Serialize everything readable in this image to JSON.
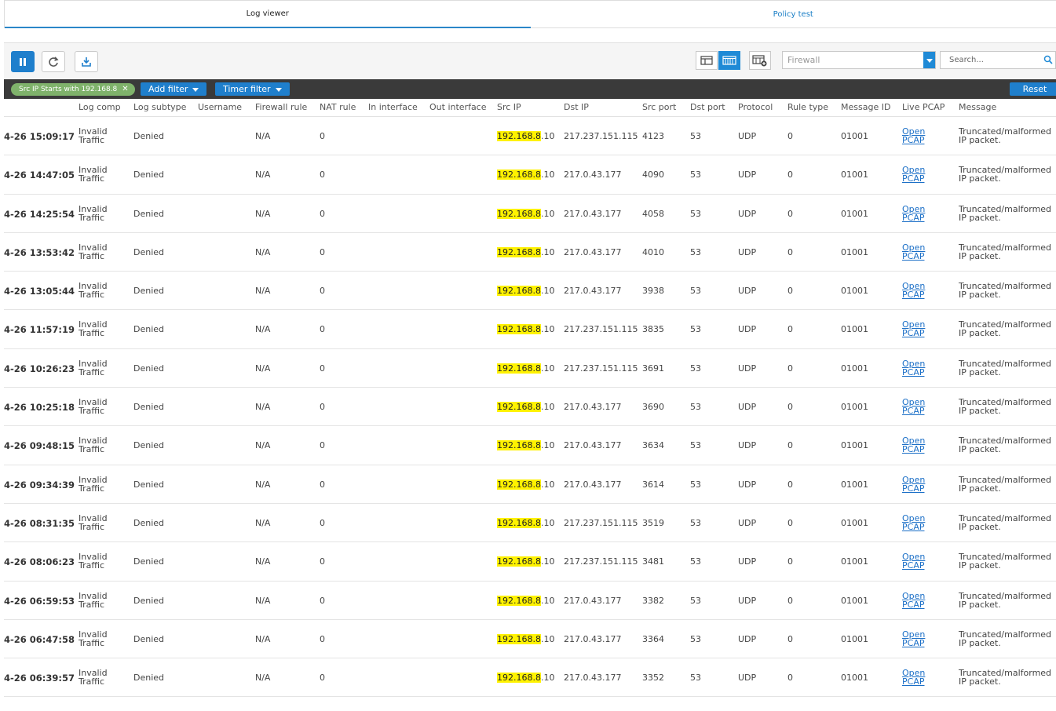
{
  "tabs": [
    {
      "label": "Log viewer",
      "active": true
    },
    {
      "label": "Policy test",
      "active": false
    }
  ],
  "toolbar": {
    "pause_icon": "pause-icon",
    "refresh_icon": "refresh-icon",
    "export_icon": "download-icon",
    "log_select_placeholder": "Firewall",
    "search_placeholder": "Search..."
  },
  "filterbar": {
    "chip_label": "Src IP Starts with 192.168.8",
    "add_filter": "Add filter",
    "timer_filter": "Timer filter",
    "reset": "Reset"
  },
  "colors": {
    "accent": "#1f7fcc",
    "chip": "#7fb26b",
    "highlight": "#fff200",
    "filterbar": "#3a3a3a"
  },
  "columns": [
    "Log comp",
    "Log subtype",
    "Username",
    "Firewall rule",
    "NAT rule",
    "In interface",
    "Out interface",
    "Src IP",
    "Dst IP",
    "Src port",
    "Dst port",
    "Protocol",
    "Rule type",
    "Message ID",
    "Live PCAP",
    "Message"
  ],
  "rows": [
    {
      "time": "4-26 15:09:17",
      "log_comp": [
        "Invalid",
        "Traffic"
      ],
      "subtype": "Denied",
      "fw_rule": "N/A",
      "nat_rule": "0",
      "src_ip_match": "192.168.8",
      "src_ip_rest": ".10",
      "dst_ip": "217.237.151.115",
      "src_port": "4123",
      "dst_port": "53",
      "protocol": "UDP",
      "rule_type": "0",
      "msg_id": "01001",
      "pcap": [
        "Open",
        "PCAP"
      ],
      "message": [
        "Truncated/malformed",
        "IP packet."
      ]
    },
    {
      "time": "4-26 14:47:05",
      "log_comp": [
        "Invalid",
        "Traffic"
      ],
      "subtype": "Denied",
      "fw_rule": "N/A",
      "nat_rule": "0",
      "src_ip_match": "192.168.8",
      "src_ip_rest": ".10",
      "dst_ip": "217.0.43.177",
      "src_port": "4090",
      "dst_port": "53",
      "protocol": "UDP",
      "rule_type": "0",
      "msg_id": "01001",
      "pcap": [
        "Open",
        "PCAP"
      ],
      "message": [
        "Truncated/malformed",
        "IP packet."
      ]
    },
    {
      "time": "4-26 14:25:54",
      "log_comp": [
        "Invalid",
        "Traffic"
      ],
      "subtype": "Denied",
      "fw_rule": "N/A",
      "nat_rule": "0",
      "src_ip_match": "192.168.8",
      "src_ip_rest": ".10",
      "dst_ip": "217.0.43.177",
      "src_port": "4058",
      "dst_port": "53",
      "protocol": "UDP",
      "rule_type": "0",
      "msg_id": "01001",
      "pcap": [
        "Open",
        "PCAP"
      ],
      "message": [
        "Truncated/malformed",
        "IP packet."
      ]
    },
    {
      "time": "4-26 13:53:42",
      "log_comp": [
        "Invalid",
        "Traffic"
      ],
      "subtype": "Denied",
      "fw_rule": "N/A",
      "nat_rule": "0",
      "src_ip_match": "192.168.8",
      "src_ip_rest": ".10",
      "dst_ip": "217.0.43.177",
      "src_port": "4010",
      "dst_port": "53",
      "protocol": "UDP",
      "rule_type": "0",
      "msg_id": "01001",
      "pcap": [
        "Open",
        "PCAP"
      ],
      "message": [
        "Truncated/malformed",
        "IP packet."
      ]
    },
    {
      "time": "4-26 13:05:44",
      "log_comp": [
        "Invalid",
        "Traffic"
      ],
      "subtype": "Denied",
      "fw_rule": "N/A",
      "nat_rule": "0",
      "src_ip_match": "192.168.8",
      "src_ip_rest": ".10",
      "dst_ip": "217.0.43.177",
      "src_port": "3938",
      "dst_port": "53",
      "protocol": "UDP",
      "rule_type": "0",
      "msg_id": "01001",
      "pcap": [
        "Open",
        "PCAP"
      ],
      "message": [
        "Truncated/malformed",
        "IP packet."
      ]
    },
    {
      "time": "4-26 11:57:19",
      "log_comp": [
        "Invalid",
        "Traffic"
      ],
      "subtype": "Denied",
      "fw_rule": "N/A",
      "nat_rule": "0",
      "src_ip_match": "192.168.8",
      "src_ip_rest": ".10",
      "dst_ip": "217.237.151.115",
      "src_port": "3835",
      "dst_port": "53",
      "protocol": "UDP",
      "rule_type": "0",
      "msg_id": "01001",
      "pcap": [
        "Open",
        "PCAP"
      ],
      "message": [
        "Truncated/malformed",
        "IP packet."
      ]
    },
    {
      "time": "4-26 10:26:23",
      "log_comp": [
        "Invalid",
        "Traffic"
      ],
      "subtype": "Denied",
      "fw_rule": "N/A",
      "nat_rule": "0",
      "src_ip_match": "192.168.8",
      "src_ip_rest": ".10",
      "dst_ip": "217.237.151.115",
      "src_port": "3691",
      "dst_port": "53",
      "protocol": "UDP",
      "rule_type": "0",
      "msg_id": "01001",
      "pcap": [
        "Open",
        "PCAP"
      ],
      "message": [
        "Truncated/malformed",
        "IP packet."
      ]
    },
    {
      "time": "4-26 10:25:18",
      "log_comp": [
        "Invalid",
        "Traffic"
      ],
      "subtype": "Denied",
      "fw_rule": "N/A",
      "nat_rule": "0",
      "src_ip_match": "192.168.8",
      "src_ip_rest": ".10",
      "dst_ip": "217.0.43.177",
      "src_port": "3690",
      "dst_port": "53",
      "protocol": "UDP",
      "rule_type": "0",
      "msg_id": "01001",
      "pcap": [
        "Open",
        "PCAP"
      ],
      "message": [
        "Truncated/malformed",
        "IP packet."
      ]
    },
    {
      "time": "4-26 09:48:15",
      "log_comp": [
        "Invalid",
        "Traffic"
      ],
      "subtype": "Denied",
      "fw_rule": "N/A",
      "nat_rule": "0",
      "src_ip_match": "192.168.8",
      "src_ip_rest": ".10",
      "dst_ip": "217.0.43.177",
      "src_port": "3634",
      "dst_port": "53",
      "protocol": "UDP",
      "rule_type": "0",
      "msg_id": "01001",
      "pcap": [
        "Open",
        "PCAP"
      ],
      "message": [
        "Truncated/malformed",
        "IP packet."
      ]
    },
    {
      "time": "4-26 09:34:39",
      "log_comp": [
        "Invalid",
        "Traffic"
      ],
      "subtype": "Denied",
      "fw_rule": "N/A",
      "nat_rule": "0",
      "src_ip_match": "192.168.8",
      "src_ip_rest": ".10",
      "dst_ip": "217.0.43.177",
      "src_port": "3614",
      "dst_port": "53",
      "protocol": "UDP",
      "rule_type": "0",
      "msg_id": "01001",
      "pcap": [
        "Open",
        "PCAP"
      ],
      "message": [
        "Truncated/malformed",
        "IP packet."
      ]
    },
    {
      "time": "4-26 08:31:35",
      "log_comp": [
        "Invalid",
        "Traffic"
      ],
      "subtype": "Denied",
      "fw_rule": "N/A",
      "nat_rule": "0",
      "src_ip_match": "192.168.8",
      "src_ip_rest": ".10",
      "dst_ip": "217.237.151.115",
      "src_port": "3519",
      "dst_port": "53",
      "protocol": "UDP",
      "rule_type": "0",
      "msg_id": "01001",
      "pcap": [
        "Open",
        "PCAP"
      ],
      "message": [
        "Truncated/malformed",
        "IP packet."
      ]
    },
    {
      "time": "4-26 08:06:23",
      "log_comp": [
        "Invalid",
        "Traffic"
      ],
      "subtype": "Denied",
      "fw_rule": "N/A",
      "nat_rule": "0",
      "src_ip_match": "192.168.8",
      "src_ip_rest": ".10",
      "dst_ip": "217.237.151.115",
      "src_port": "3481",
      "dst_port": "53",
      "protocol": "UDP",
      "rule_type": "0",
      "msg_id": "01001",
      "pcap": [
        "Open",
        "PCAP"
      ],
      "message": [
        "Truncated/malformed",
        "IP packet."
      ]
    },
    {
      "time": "4-26 06:59:53",
      "log_comp": [
        "Invalid",
        "Traffic"
      ],
      "subtype": "Denied",
      "fw_rule": "N/A",
      "nat_rule": "0",
      "src_ip_match": "192.168.8",
      "src_ip_rest": ".10",
      "dst_ip": "217.0.43.177",
      "src_port": "3382",
      "dst_port": "53",
      "protocol": "UDP",
      "rule_type": "0",
      "msg_id": "01001",
      "pcap": [
        "Open",
        "PCAP"
      ],
      "message": [
        "Truncated/malformed",
        "IP packet."
      ]
    },
    {
      "time": "4-26 06:47:58",
      "log_comp": [
        "Invalid",
        "Traffic"
      ],
      "subtype": "Denied",
      "fw_rule": "N/A",
      "nat_rule": "0",
      "src_ip_match": "192.168.8",
      "src_ip_rest": ".10",
      "dst_ip": "217.0.43.177",
      "src_port": "3364",
      "dst_port": "53",
      "protocol": "UDP",
      "rule_type": "0",
      "msg_id": "01001",
      "pcap": [
        "Open",
        "PCAP"
      ],
      "message": [
        "Truncated/malformed",
        "IP packet."
      ]
    },
    {
      "time": "4-26 06:39:57",
      "log_comp": [
        "Invalid",
        "Traffic"
      ],
      "subtype": "Denied",
      "fw_rule": "N/A",
      "nat_rule": "0",
      "src_ip_match": "192.168.8",
      "src_ip_rest": ".10",
      "dst_ip": "217.0.43.177",
      "src_port": "3352",
      "dst_port": "53",
      "protocol": "UDP",
      "rule_type": "0",
      "msg_id": "01001",
      "pcap": [
        "Open",
        "PCAP"
      ],
      "message": [
        "Truncated/malformed",
        "IP packet."
      ]
    }
  ]
}
